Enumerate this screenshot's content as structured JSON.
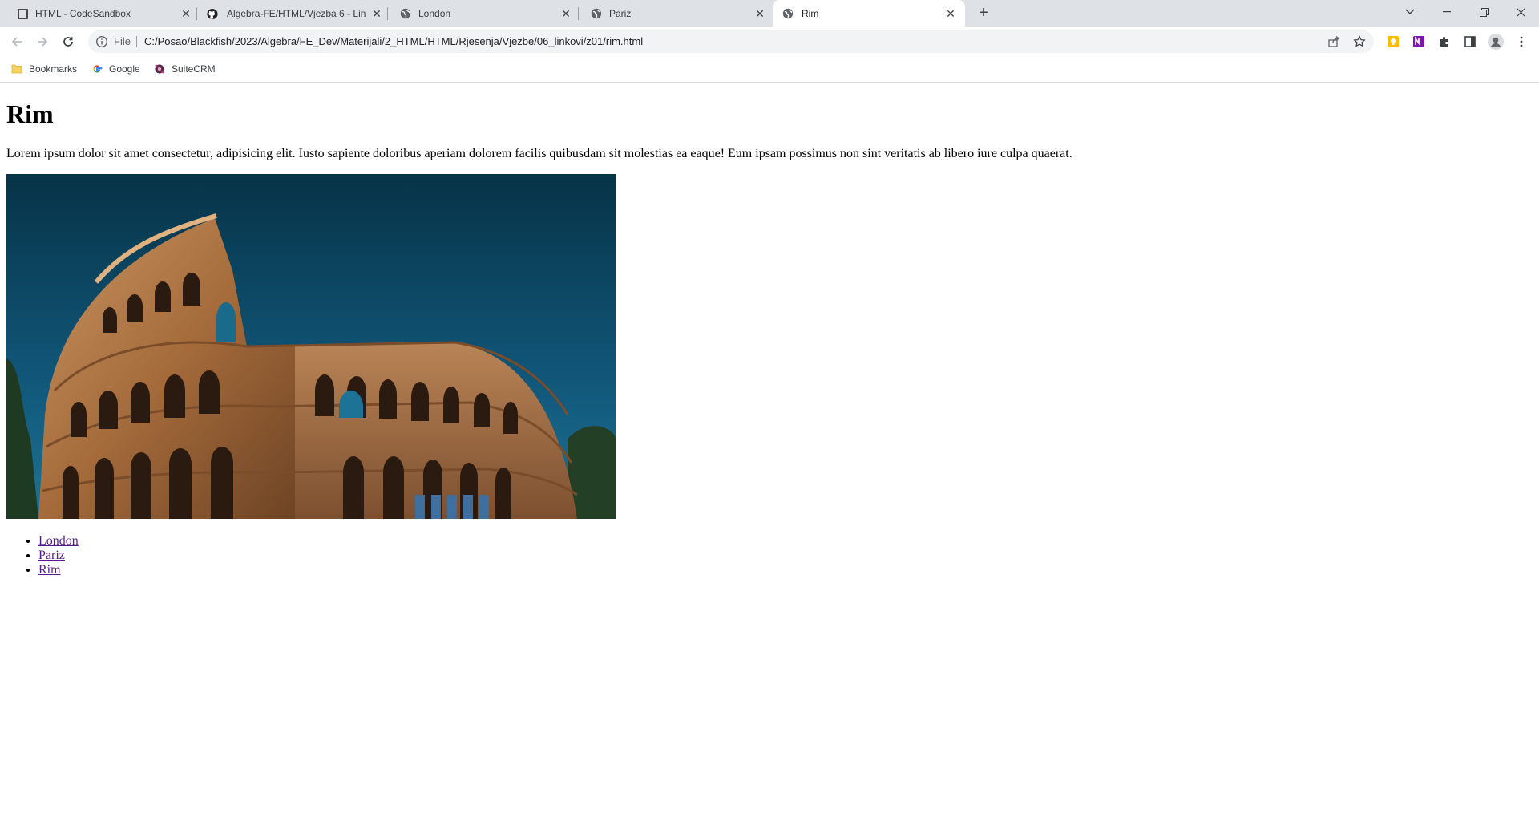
{
  "browser": {
    "tabs": [
      {
        "title": "HTML - CodeSandbox",
        "favicon": "codesandbox-icon",
        "active": false
      },
      {
        "title": "Algebra-FE/HTML/Vjezba 6 - Lin",
        "favicon": "github-icon",
        "active": false
      },
      {
        "title": "London",
        "favicon": "globe-icon",
        "active": false
      },
      {
        "title": "Pariz",
        "favicon": "globe-icon",
        "active": false
      },
      {
        "title": "Rim",
        "favicon": "globe-icon",
        "active": true
      }
    ],
    "new_tab_label": "+",
    "address": {
      "scheme_label": "File",
      "url": "C:/Posao/Blackfish/2023/Algebra/FE_Dev/Materijali/2_HTML/HTML/Rjesenja/Vjezbe/06_linkovi/z01/rim.html"
    },
    "bookmarks": [
      {
        "label": "Bookmarks",
        "icon": "folder-icon"
      },
      {
        "label": "Google",
        "icon": "google-icon"
      },
      {
        "label": "SuiteCRM",
        "icon": "suitecrm-icon"
      }
    ]
  },
  "page": {
    "heading": "Rim",
    "paragraph": "Lorem ipsum dolor sit amet consectetur, adipisicing elit. Iusto sapiente doloribus aperiam dolorem facilis quibusdam sit molestias ea eaque! Eum ipsam possimus non sint veritatis ab libero iure culpa quaerat.",
    "image_subject": "Colosseum, Rome",
    "links": [
      "London",
      "Pariz",
      "Rim"
    ]
  },
  "colors": {
    "tabstrip": "#dee1e6",
    "visited_link": "#551a8b",
    "sky_top": "#0b3b54",
    "sky_bottom": "#1a6f8f",
    "stone": "#b07a4a"
  }
}
